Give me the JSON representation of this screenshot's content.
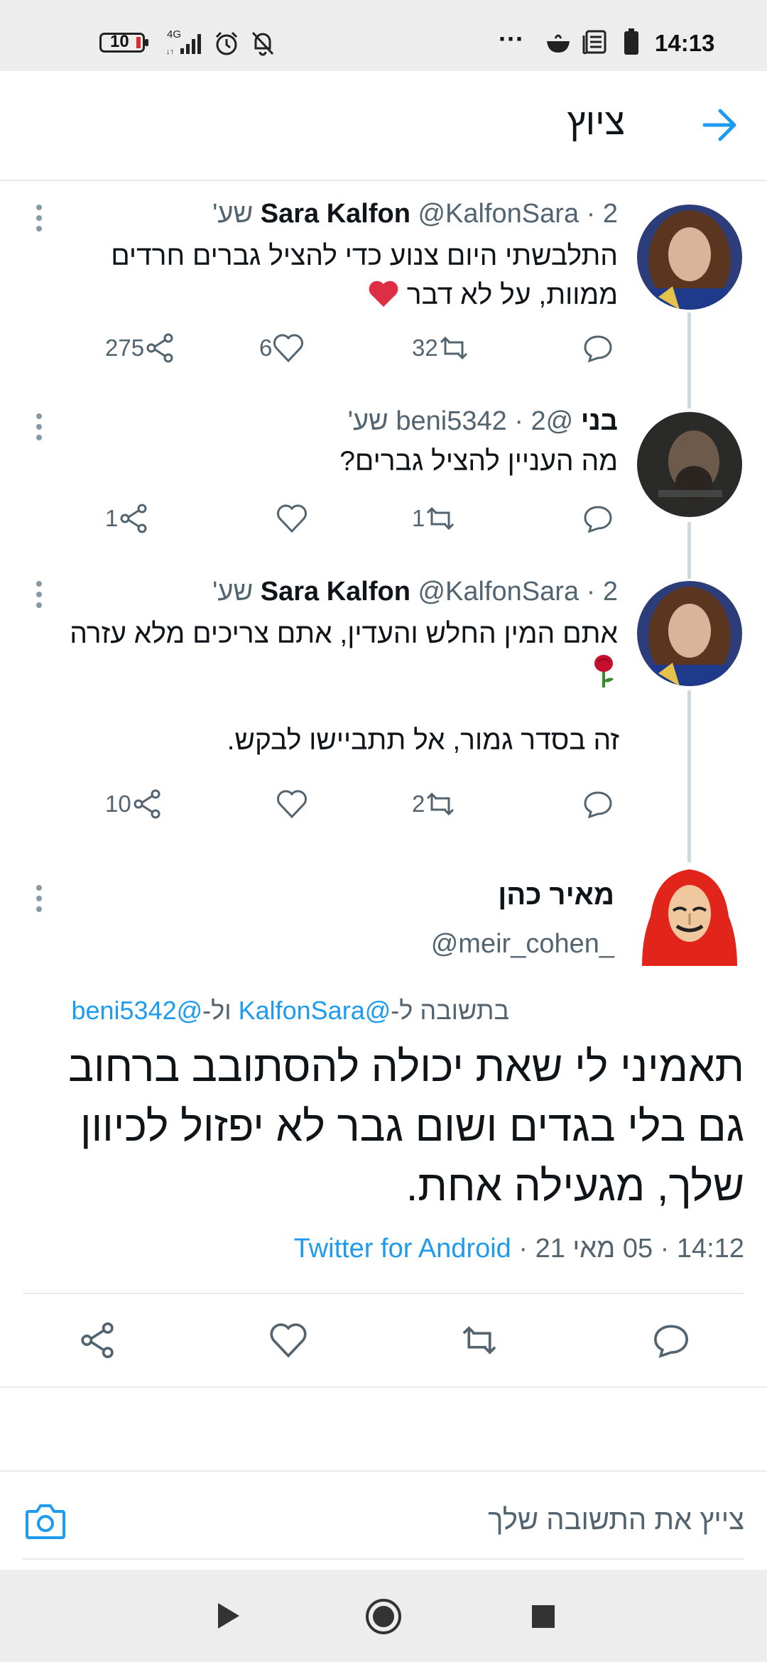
{
  "status_bar": {
    "battery_level": "10",
    "network": "4G",
    "time": "14:13",
    "more": "···"
  },
  "header": {
    "title": "ציוץ"
  },
  "tweets": [
    {
      "name": "Sara Kalfon",
      "handle": "@KalfonSara",
      "time": "· 2 שע'",
      "text_lines": [
        "התלבשתי היום צנוע כדי להציל גברים חרדים",
        "ממוות, על לא דבר"
      ],
      "emoji": "heart",
      "replies": "",
      "retweets": "32",
      "likes": "6",
      "shares": "275"
    },
    {
      "name": "בני",
      "handle": "@beni5342",
      "time": "· 2 שע'",
      "text_lines": [
        "מה העניין להציל גברים?"
      ],
      "replies": "",
      "retweets": "1",
      "likes": "",
      "shares": "1"
    },
    {
      "name": "Sara Kalfon",
      "handle": "@KalfonSara",
      "time": "· 2 שע'",
      "text_lines": [
        "אתם המין החלש והעדין, אתם צריכים מלא עזרה"
      ],
      "emoji": "rose",
      "text_extra": "זה בסדר גמור, אל תתביישו לבקש.",
      "replies": "",
      "retweets": "2",
      "likes": "",
      "shares": "10"
    }
  ],
  "main_tweet": {
    "name": "מאיר כהן",
    "handle": "@meir_cohen_",
    "reply_prefix": "בתשובה ל-",
    "reply_user1": "@KalfonSara",
    "reply_joiner": " ול-",
    "reply_user2": "@beni5342",
    "text_lines": [
      "תאמיני לי שאת יכולה להסתובב ברחוב",
      "גם בלי בגדים ושום גבר לא יפזול לכיוון",
      "שלך, מגעילה אחת."
    ],
    "time": "14:12",
    "date": "05 מאי 21",
    "source": "Twitter for Android"
  },
  "reply_bar": {
    "placeholder": "צייץ את התשובה שלך"
  },
  "colors": {
    "accent": "#1d9bf0",
    "muted": "#536471",
    "divider": "#e6ecf0"
  }
}
